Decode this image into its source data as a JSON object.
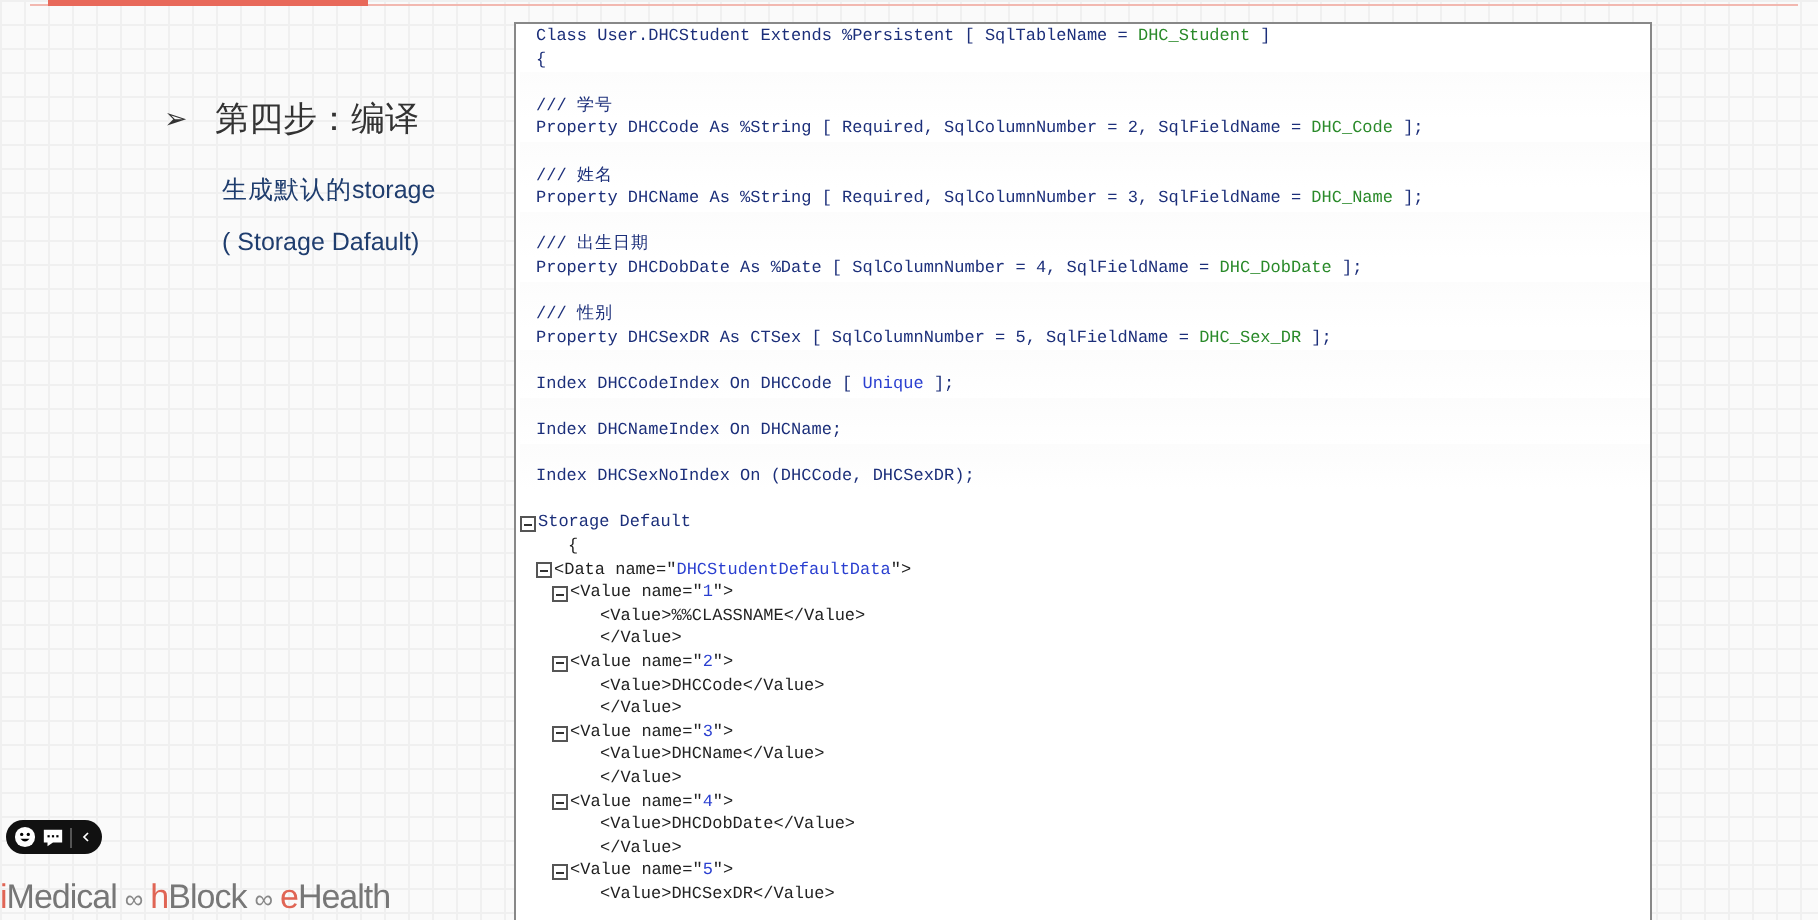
{
  "slide": {
    "bullet": "➢",
    "heading": "第四步：编译",
    "notes": [
      "生成默认的storage",
      "( Storage Dafault)"
    ]
  },
  "code_lines": [
    {
      "spaced": false,
      "segments": [
        {
          "text": "Class User.",
          "kind": "kw"
        },
        {
          "text": "DHCStudent",
          "kind": "kw"
        },
        {
          "text": " Extends %Persistent [ SqlTableName = ",
          "kind": "kw"
        },
        {
          "text": "DHC_Student",
          "kind": "name"
        },
        {
          "text": " ]",
          "kind": "kw"
        }
      ]
    },
    {
      "spaced": false,
      "segments": [
        {
          "text": "{",
          "kind": "kw"
        }
      ]
    },
    {
      "spaced": true,
      "segments": [
        {
          "text": "/// 学号",
          "kind": "kw"
        }
      ]
    },
    {
      "spaced": false,
      "segments": [
        {
          "text": "Property DHCCode As %String [ Required, SqlColumnNumber = 2, SqlFieldName = ",
          "kind": "kw"
        },
        {
          "text": "DHC_Code",
          "kind": "name"
        },
        {
          "text": " ];",
          "kind": "kw"
        }
      ]
    },
    {
      "spaced": true,
      "segments": [
        {
          "text": "/// 姓名",
          "kind": "kw"
        }
      ]
    },
    {
      "spaced": false,
      "segments": [
        {
          "text": "Property DHCName As %String [ Required, SqlColumnNumber = 3, SqlFieldName = ",
          "kind": "kw"
        },
        {
          "text": "DHC_Name",
          "kind": "name"
        },
        {
          "text": " ];",
          "kind": "kw"
        }
      ]
    },
    {
      "spaced": true,
      "segments": [
        {
          "text": "/// 出生日期",
          "kind": "kw"
        }
      ]
    },
    {
      "spaced": false,
      "segments": [
        {
          "text": "Property DHCDobDate As %Date [ SqlColumnNumber = 4, SqlFieldName = ",
          "kind": "kw"
        },
        {
          "text": "DHC_DobDate",
          "kind": "name"
        },
        {
          "text": " ];",
          "kind": "kw"
        }
      ]
    },
    {
      "spaced": true,
      "segments": [
        {
          "text": "/// 性别",
          "kind": "kw"
        }
      ]
    },
    {
      "spaced": false,
      "segments": [
        {
          "text": "Property DHCSexDR As CTSex [ SqlColumnNumber = 5, SqlFieldName = ",
          "kind": "kw"
        },
        {
          "text": "DHC_Sex_DR",
          "kind": "name"
        },
        {
          "text": " ];",
          "kind": "kw"
        }
      ]
    },
    {
      "spaced": true,
      "segments": [
        {
          "text": "Index DHCCodeIndex On DHCCode [ ",
          "kind": "kw"
        },
        {
          "text": "Unique",
          "kind": "str"
        },
        {
          "text": " ];",
          "kind": "kw"
        }
      ]
    },
    {
      "spaced": true,
      "segments": [
        {
          "text": "Index DHCNameIndex On DHCName;",
          "kind": "kw"
        }
      ]
    },
    {
      "spaced": true,
      "segments": [
        {
          "text": "Index DHCSexNoIndex On (DHCCode, DHCSexDR);",
          "kind": "kw"
        }
      ]
    }
  ],
  "storage": [
    {
      "fold": true,
      "segments": [
        {
          "text": "Storage Default",
          "kind": "kw"
        }
      ],
      "children": [
        {
          "fold": false,
          "segments": [
            {
              "text": "{",
              "kind": "plain"
            }
          ]
        },
        {
          "fold": true,
          "segments": [
            {
              "text": "<Data name=\"",
              "kind": "plain"
            },
            {
              "text": "DHCStudentDefaultData",
              "kind": "str"
            },
            {
              "text": "\">",
              "kind": "plain"
            }
          ],
          "children": [
            {
              "fold": true,
              "segments": [
                {
                  "text": "<Value name=\"",
                  "kind": "plain"
                },
                {
                  "text": "1",
                  "kind": "str"
                },
                {
                  "text": "\">",
                  "kind": "plain"
                }
              ],
              "children": [
                {
                  "fold": false,
                  "segments": [
                    {
                      "text": "<Value>%%CLASSNAME</Value>",
                      "kind": "plain"
                    }
                  ]
                }
              ],
              "closing": "</Value>"
            },
            {
              "fold": true,
              "segments": [
                {
                  "text": "<Value name=\"",
                  "kind": "plain"
                },
                {
                  "text": "2",
                  "kind": "str"
                },
                {
                  "text": "\">",
                  "kind": "plain"
                }
              ],
              "children": [
                {
                  "fold": false,
                  "segments": [
                    {
                      "text": "<Value>DHCCode</Value>",
                      "kind": "plain"
                    }
                  ]
                }
              ],
              "closing": "</Value>"
            },
            {
              "fold": true,
              "segments": [
                {
                  "text": "<Value name=\"",
                  "kind": "plain"
                },
                {
                  "text": "3",
                  "kind": "str"
                },
                {
                  "text": "\">",
                  "kind": "plain"
                }
              ],
              "children": [
                {
                  "fold": false,
                  "segments": [
                    {
                      "text": "<Value>DHCName</Value>",
                      "kind": "plain"
                    }
                  ]
                }
              ],
              "closing": "</Value>"
            },
            {
              "fold": true,
              "segments": [
                {
                  "text": "<Value name=\"",
                  "kind": "plain"
                },
                {
                  "text": "4",
                  "kind": "str"
                },
                {
                  "text": "\">",
                  "kind": "plain"
                }
              ],
              "children": [
                {
                  "fold": false,
                  "segments": [
                    {
                      "text": "<Value>DHCDobDate</Value>",
                      "kind": "plain"
                    }
                  ]
                }
              ],
              "closing": "</Value>"
            },
            {
              "fold": true,
              "segments": [
                {
                  "text": "<Value name=\"",
                  "kind": "plain"
                },
                {
                  "text": "5",
                  "kind": "str"
                },
                {
                  "text": "\">",
                  "kind": "plain"
                }
              ],
              "children": [
                {
                  "fold": false,
                  "segments": [
                    {
                      "text": "<Value>DHCSexDR</Value>",
                      "kind": "plain"
                    }
                  ]
                }
              ]
            }
          ]
        }
      ]
    }
  ],
  "logo": [
    {
      "kind": "word",
      "initial": "i",
      "rest": "Medical"
    },
    {
      "kind": "sep",
      "text": "∞"
    },
    {
      "kind": "word",
      "initial": "h",
      "rest": "Block"
    },
    {
      "kind": "sep",
      "text": "∞"
    },
    {
      "kind": "word",
      "initial": "e",
      "rest": "Health"
    }
  ]
}
